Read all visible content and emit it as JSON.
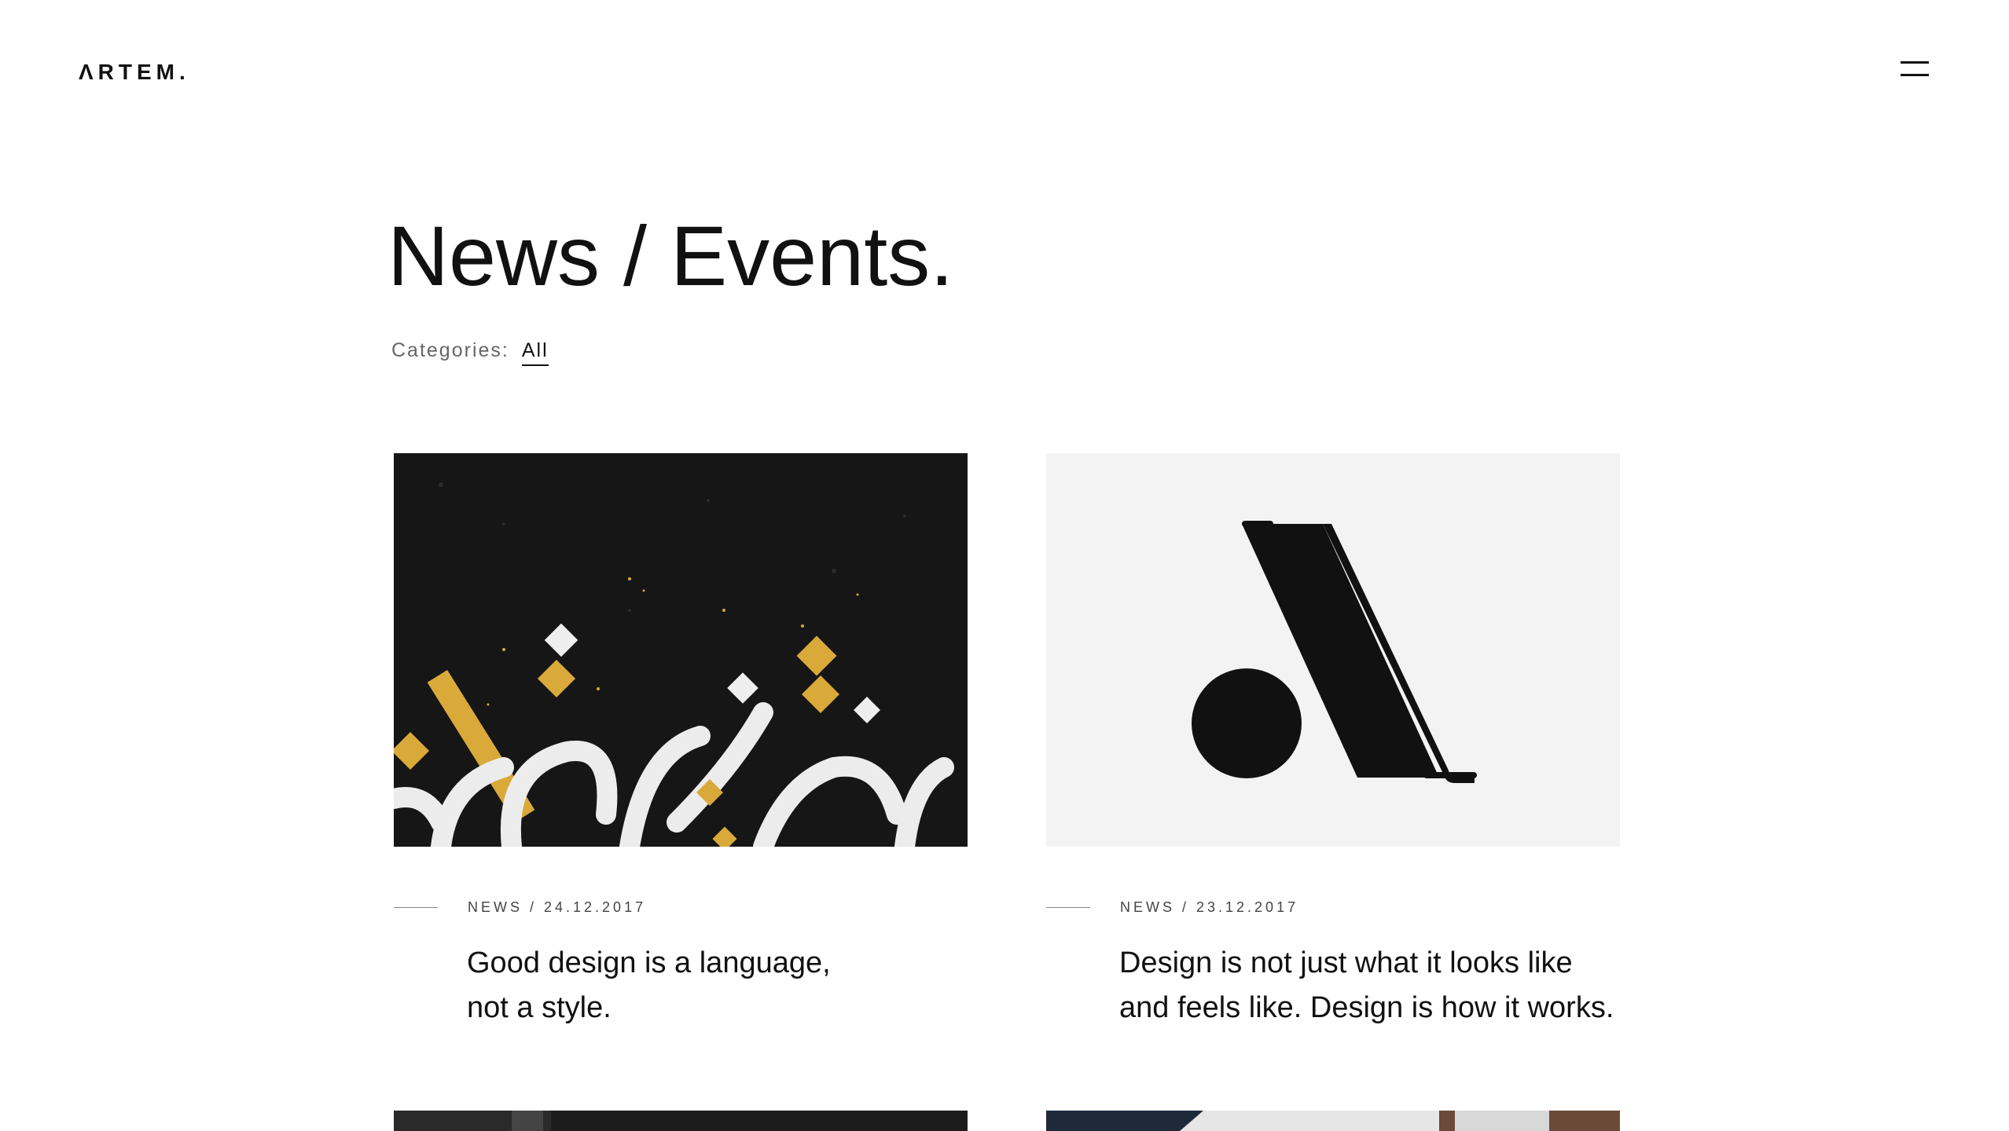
{
  "header": {
    "logo_text": "ΛRTEM."
  },
  "main": {
    "title": "News / Events.",
    "categories_label": "Categories:",
    "categories": [
      {
        "label": "All",
        "active": true
      }
    ]
  },
  "posts": [
    {
      "meta": "NEWS / 24.12.2017",
      "title_lines": [
        "Good design is a language,",
        "not a style."
      ],
      "image": "calligraphy-art-image"
    },
    {
      "meta": "NEWS / 23.12.2017",
      "title_lines": [
        "Design is not just what it looks like",
        "and feels like. Design is how it works."
      ],
      "image": "artem-logo-image"
    }
  ],
  "colors": {
    "text": "#111111",
    "muted": "#666666",
    "gold": "#d9a93a",
    "light_bg": "#f3f3f3"
  }
}
